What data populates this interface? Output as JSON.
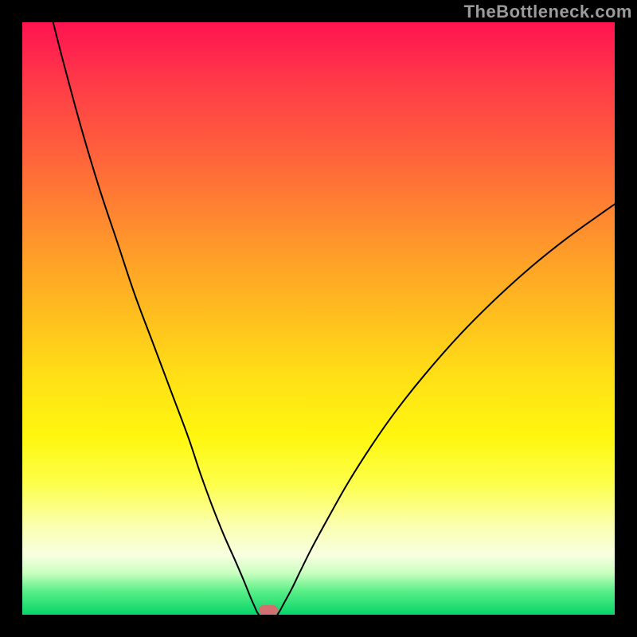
{
  "watermark": "TheBottleneck.com",
  "chart_data": {
    "type": "line",
    "title": "",
    "xlabel": "",
    "ylabel": "",
    "xlim": [
      0,
      100
    ],
    "ylim": [
      0,
      100
    ],
    "series": [
      {
        "name": "left-branch",
        "x": [
          5.2,
          7,
          10,
          13,
          16,
          19,
          22,
          25,
          28,
          30,
          32,
          34,
          36,
          37.5,
          38.5,
          39.2,
          39.6,
          39.9
        ],
        "y": [
          100,
          93,
          82,
          72,
          63,
          54,
          46,
          38,
          30,
          24,
          18.5,
          13.5,
          9,
          5.5,
          3,
          1.4,
          0.5,
          0.05
        ]
      },
      {
        "name": "right-branch",
        "x": [
          43.1,
          43.5,
          44.2,
          45.5,
          47,
          49,
          52,
          55,
          59,
          63,
          68,
          74,
          80,
          86,
          92,
          98,
          100
        ],
        "y": [
          0.05,
          0.7,
          2,
          4.4,
          7.5,
          11.5,
          17,
          22.3,
          28.6,
          34.3,
          40.6,
          47.4,
          53.4,
          58.8,
          63.6,
          67.9,
          69.3
        ]
      }
    ],
    "gradient_stops": [
      {
        "pos": 0,
        "color": "#ff1450"
      },
      {
        "pos": 10,
        "color": "#ff3a48"
      },
      {
        "pos": 30,
        "color": "#ff7d33"
      },
      {
        "pos": 50,
        "color": "#ffc01e"
      },
      {
        "pos": 70,
        "color": "#fff70f"
      },
      {
        "pos": 90,
        "color": "#f7ffe0"
      },
      {
        "pos": 100,
        "color": "#07d56a"
      }
    ],
    "marker": {
      "x_center": 41.5,
      "width": 3.2,
      "y_bottom": 0,
      "height": 1.6,
      "color": "#d07070"
    }
  }
}
